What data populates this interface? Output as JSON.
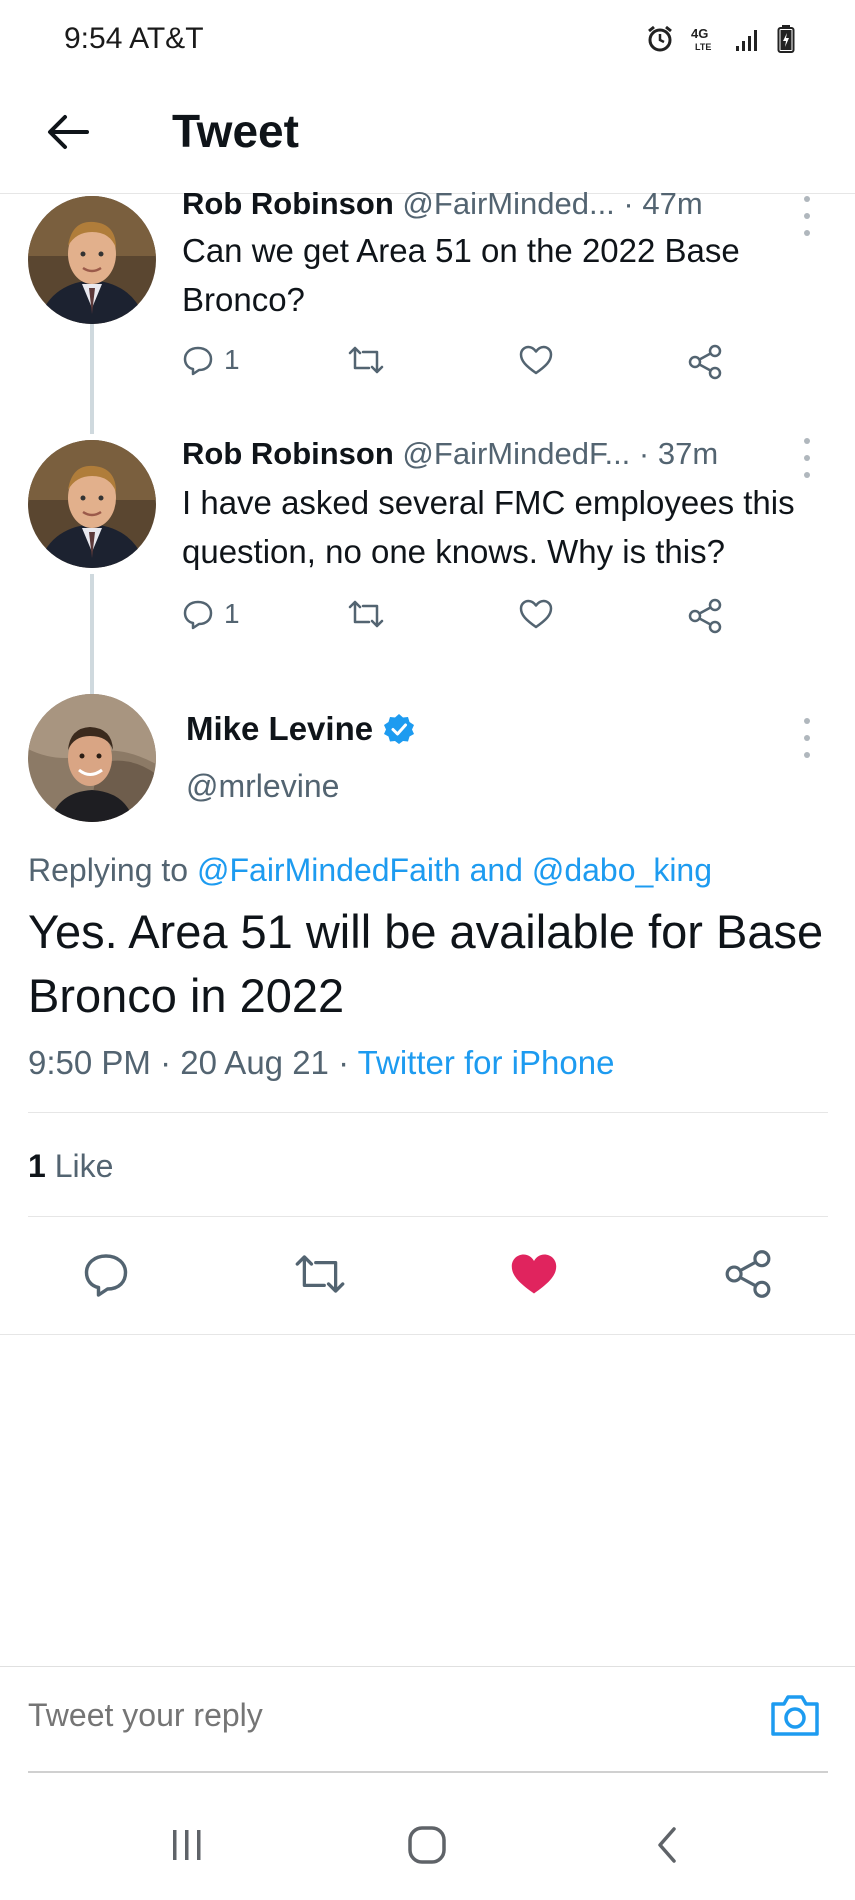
{
  "status_bar": {
    "time": "9:54",
    "carrier": "AT&T",
    "network": "4G LTE"
  },
  "header": {
    "title": "Tweet"
  },
  "thread": [
    {
      "name": "Rob Robinson",
      "handle": "@FairMinded...",
      "time": "· 47m",
      "text": "Can we get Area 51 on the 2022 Base Bronco?",
      "reply_count": "1"
    },
    {
      "name": "Rob Robinson",
      "handle": "@FairMindedF...",
      "time": "· 37m",
      "text": "I have asked several FMC employees this question, no one knows. Why is this?",
      "reply_count": "1"
    }
  ],
  "main_tweet": {
    "name": "Mike Levine",
    "handle": "@mrlevine",
    "replying_prefix": "Replying to",
    "replying_user1": "@FairMindedFaith",
    "replying_and": "and",
    "replying_user2": "@dabo_king",
    "text": "Yes. Area 51 will be available for Base Bronco in 2022",
    "time": "9:50 PM",
    "date": "20 Aug 21",
    "source": "Twitter for iPhone",
    "like_count": "1",
    "like_label": "Like",
    "liked": true
  },
  "reply_bar": {
    "placeholder": "Tweet your reply"
  },
  "colors": {
    "accent": "#1d9bf0",
    "like": "#e0245e",
    "text": "#0f1419",
    "muted": "#536471"
  }
}
